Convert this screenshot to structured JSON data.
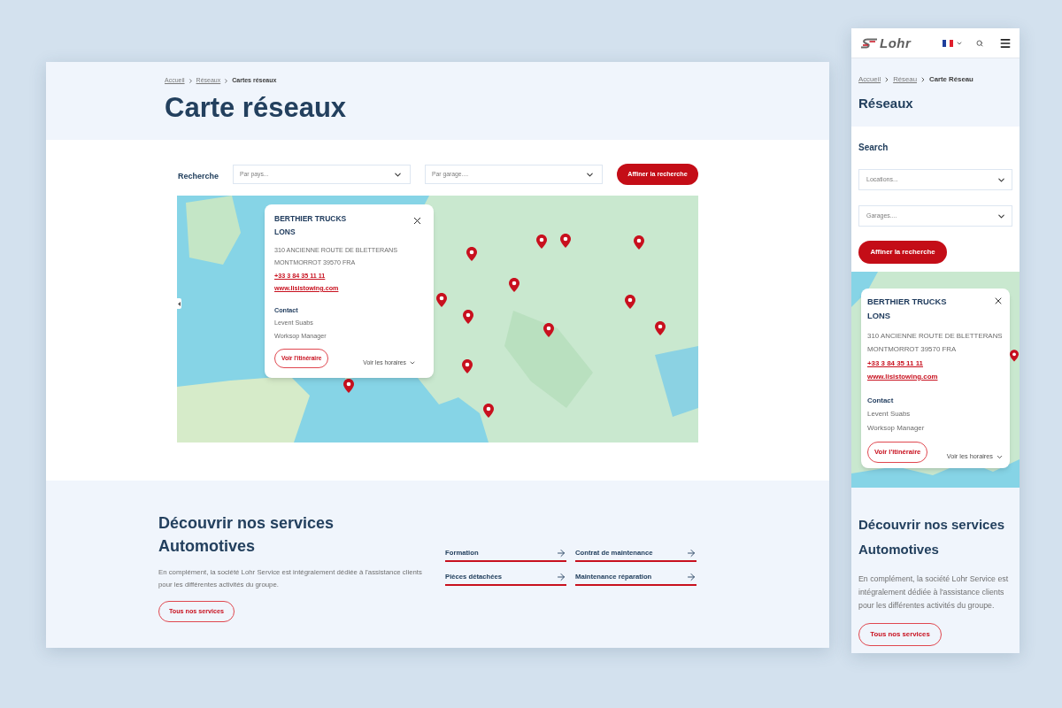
{
  "desktop": {
    "breadcrumb": [
      {
        "label": "Accueil",
        "current": false
      },
      {
        "label": "Réseaux",
        "current": false
      },
      {
        "label": "Cartes réseaux",
        "current": true
      }
    ],
    "title": "Carte réseaux",
    "search": {
      "label": "Recherche",
      "fields": [
        {
          "placeholder": "Par pays..."
        },
        {
          "placeholder": "Par garage...."
        }
      ],
      "button": "Affiner la recherche"
    },
    "popup": {
      "name": "BERTHIER TRUCKS",
      "city": "LONS",
      "address": [
        "310 ANCIENNE ROUTE DE BLETTERANS",
        "MONTMORROT 39570 FRA"
      ],
      "phone": "+33 3 84 35 11 11",
      "website": "www.lisistowing.com",
      "contact_label": "Contact",
      "contact_name": "Levent Suabs",
      "contact_role": "Worksop Manager",
      "route_button": "Voir l'itinéraire",
      "hours_toggle": "Voir les horaires"
    },
    "services": {
      "title": "Découvrir nos services Automotives",
      "text": "En complément, la société Lohr Service est intégralement dédiée à l'assistance clients pour les différentes activités du groupe.",
      "button": "Tous nos services",
      "links": [
        "Formation",
        "Contrat de maintenance",
        "Pièces détachées",
        "Maintenance réparation"
      ]
    }
  },
  "mobile": {
    "logo": "Lohr",
    "breadcrumb": [
      {
        "label": "Accueil",
        "current": false
      },
      {
        "label": "Réseau",
        "current": false
      },
      {
        "label": "Carte Réseau",
        "current": true
      }
    ],
    "title": "Réseaux",
    "search": {
      "label": "Search",
      "fields": [
        {
          "placeholder": "Locations..."
        },
        {
          "placeholder": "Garages...."
        }
      ],
      "button": "Affiner la recherche"
    },
    "popup": {
      "name": "BERTHIER TRUCKS",
      "city": "LONS",
      "address": [
        "310 ANCIENNE ROUTE DE BLETTERANS",
        "MONTMORROT 39570 FRA"
      ],
      "phone": "+33 3 84 35 11 11",
      "website": "www.lisistowing.com",
      "contact_label": "Contact",
      "contact_name": "Levent Suabs",
      "contact_role": "Worksop Manager",
      "route_button": "Voir l'itinéraire",
      "hours_toggle": "Voir les horaires"
    },
    "services": {
      "title": "Découvrir nos services Automotives",
      "text": "En complément, la société Lohr Service est intégralement dédiée à l'assistance clients pour les différentes activités du groupe.",
      "button": "Tous nos services"
    }
  }
}
